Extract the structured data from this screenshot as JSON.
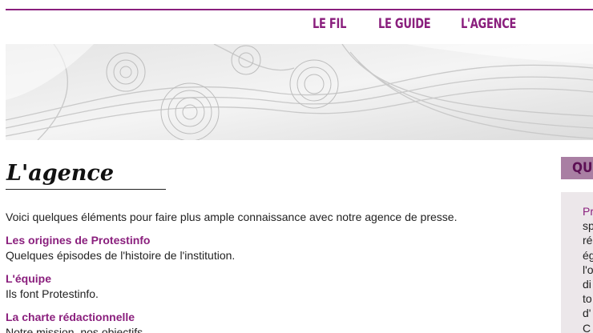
{
  "nav": {
    "items": [
      {
        "label": "LE FIL"
      },
      {
        "label": "LE GUIDE"
      },
      {
        "label": "L'AGENCE"
      }
    ]
  },
  "banner": {
    "image": "paper-rolls-photo"
  },
  "page": {
    "title": "L'agence",
    "intro": "Voici quelques éléments pour faire plus ample connaissance avec notre agence de presse."
  },
  "sections": [
    {
      "title": "Les origines de Protestinfo",
      "desc": "Quelques épisodes de l'histoire de l'institution."
    },
    {
      "title": "L'équipe",
      "desc": "Ils font Protestinfo."
    },
    {
      "title": "La charte rédactionnelle",
      "desc": "Notre mission, nos objectifs."
    }
  ],
  "sidebar": {
    "heading": "QU'",
    "lines": [
      "Pr",
      "sp",
      "ré",
      "ég",
      "l'o",
      "di",
      "to",
      "d'",
      "",
      "C"
    ]
  },
  "colors": {
    "accent": "#8a1f7d",
    "sidebar_bg": "#ece7ea",
    "sidebar_header": "#a97fa3"
  }
}
